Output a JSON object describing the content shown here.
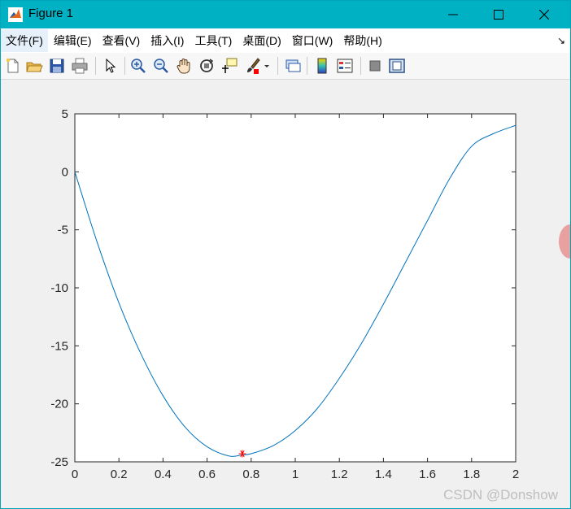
{
  "window": {
    "title": "Figure 1"
  },
  "menu": {
    "items": [
      {
        "label": "文件(F)"
      },
      {
        "label": "编辑(E)"
      },
      {
        "label": "查看(V)"
      },
      {
        "label": "插入(I)"
      },
      {
        "label": "工具(T)"
      },
      {
        "label": "桌面(D)"
      },
      {
        "label": "窗口(W)"
      },
      {
        "label": "帮助(H)"
      }
    ]
  },
  "toolbar": {
    "icons": [
      "new-figure-icon",
      "open-file-icon",
      "save-icon",
      "print-icon",
      "select-arrow-icon",
      "zoom-in-icon",
      "zoom-out-icon",
      "pan-hand-icon",
      "rotate-3d-icon",
      "data-cursor-icon",
      "brush-icon",
      "link-plot-icon",
      "colorbar-icon",
      "legend-icon",
      "hide-plot-tools-icon",
      "show-plot-tools-icon"
    ]
  },
  "watermark": "CSDN @Donshow",
  "chart_data": {
    "type": "line",
    "title": "",
    "xlabel": "",
    "ylabel": "",
    "xlim": [
      0,
      2
    ],
    "ylim": [
      -25,
      5
    ],
    "grid": false,
    "x_ticks": [
      0,
      0.2,
      0.4,
      0.6,
      0.8,
      1,
      1.2,
      1.4,
      1.6,
      1.8,
      2
    ],
    "x_tick_labels": [
      "0",
      "0.2",
      "0.4",
      "0.6",
      "0.8",
      "1",
      "1.2",
      "1.4",
      "1.6",
      "1.8",
      "2"
    ],
    "y_ticks": [
      5,
      0,
      -5,
      -10,
      -15,
      -20,
      -25
    ],
    "y_tick_labels": [
      "5",
      "0",
      "-5",
      "-10",
      "-15",
      "-20",
      "-25"
    ],
    "series": [
      {
        "type": "line",
        "color": "#0072bd",
        "x": [
          0,
          0.1,
          0.2,
          0.3,
          0.4,
          0.5,
          0.6,
          0.7,
          0.76,
          0.8,
          0.9,
          1.0,
          1.1,
          1.2,
          1.3,
          1.4,
          1.5,
          1.6,
          1.7,
          1.8,
          1.9,
          2.0
        ],
        "y": [
          0,
          -6.0,
          -11.3,
          -15.7,
          -19.3,
          -22.0,
          -23.7,
          -24.5,
          -24.4,
          -24.3,
          -23.6,
          -22.3,
          -20.4,
          -17.8,
          -14.8,
          -11.4,
          -7.8,
          -4.2,
          -0.6,
          2.2,
          3.3,
          4.0
        ]
      },
      {
        "type": "scatter",
        "marker": "*",
        "color": "#ff0000",
        "x": [
          0.76
        ],
        "y": [
          -24.3
        ]
      }
    ]
  },
  "colors": {
    "titlebar": "#00b1c4",
    "line": "#0072bd",
    "marker": "#ff0000"
  }
}
